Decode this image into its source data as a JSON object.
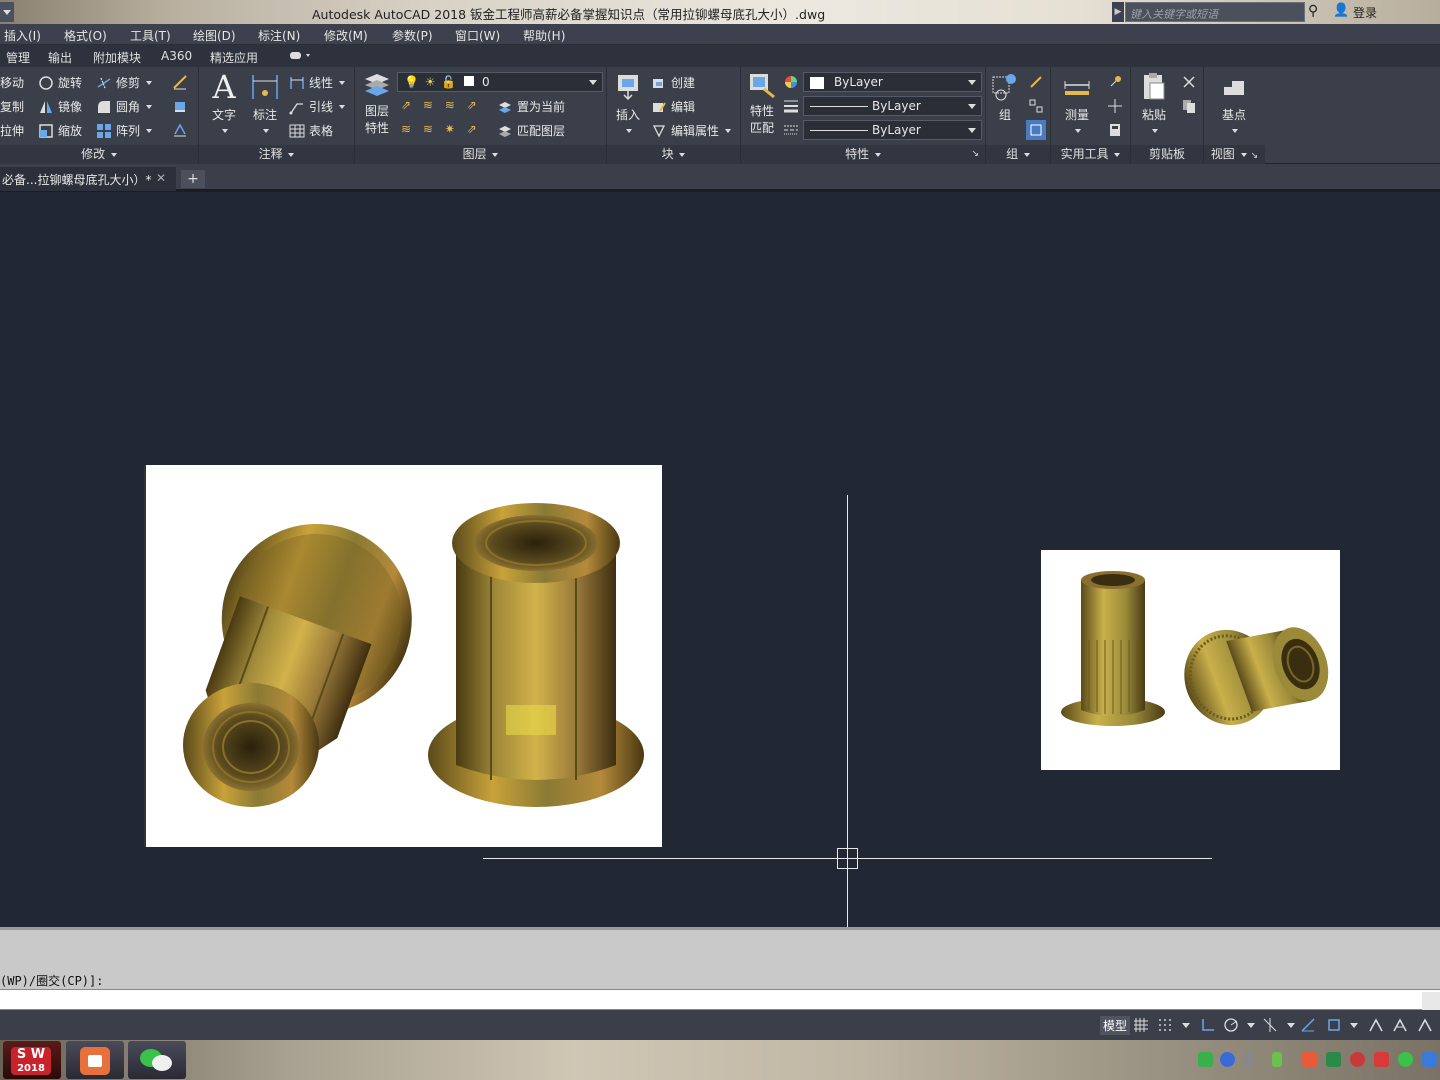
{
  "window": {
    "title": "Autodesk AutoCAD 2018    钣金工程师高薪必备掌握知识点（常用拉铆螺母底孔大小）.dwg",
    "search_placeholder": "键入关键字或短语",
    "login_label": "登录"
  },
  "menu": {
    "items": [
      "插入(I)",
      "格式(O)",
      "工具(T)",
      "绘图(D)",
      "标注(N)",
      "修改(M)",
      "参数(P)",
      "窗口(W)",
      "帮助(H)"
    ]
  },
  "ribbon_tabs": {
    "items": [
      "管理",
      "输出",
      "附加模块",
      "A360",
      "精选应用"
    ]
  },
  "ribbon": {
    "modify": {
      "label": "修改",
      "move": "移动",
      "rotate": "旋转",
      "trim": "修剪",
      "copy": "复制",
      "mirror": "镜像",
      "fillet": "圆角",
      "stretch": "拉伸",
      "scale": "缩放",
      "array": "阵列"
    },
    "annotation": {
      "label": "注释",
      "text": "文字",
      "dimension": "标注",
      "linear": "线性",
      "leader": "引线",
      "table": "表格"
    },
    "layers": {
      "label": "图层",
      "layer_props": [
        "图层",
        "特性"
      ],
      "current_layer": "0",
      "set_current": "置为当前",
      "match_layer": "匹配图层"
    },
    "block": {
      "label": "块",
      "insert": "插入",
      "create": "创建",
      "edit": "编辑",
      "edit_attributes": "编辑属性"
    },
    "properties": {
      "label": "特性",
      "match_props": [
        "特性",
        "匹配"
      ],
      "color": "ByLayer",
      "linetype": "ByLayer",
      "lineweight": "ByLayer"
    },
    "groups": {
      "label": "组",
      "group": "组"
    },
    "utilities": {
      "label": "实用工具",
      "measure": "测量"
    },
    "clipboard": {
      "label": "剪贴板",
      "paste": "粘贴"
    },
    "view": {
      "label": "视图",
      "base": "基点"
    }
  },
  "file_tab": {
    "name": "必备...拉铆螺母底孔大小）*",
    "close": "✕",
    "new": "+"
  },
  "command": {
    "history_line": "(WP)/圈交(CP)]:",
    "input": ""
  },
  "status": {
    "model_label": "模型"
  },
  "colors": {
    "canvas_bg": "#212833",
    "ribbon_bg": "#3a3f4a",
    "crosshair": "#e8e8e8"
  },
  "icons": {
    "taskbar": [
      "solidworks-2018-icon",
      "video-app-icon",
      "wechat-icon"
    ]
  },
  "taskbar": {
    "solidworks_label": [
      "S W",
      "2018"
    ]
  }
}
